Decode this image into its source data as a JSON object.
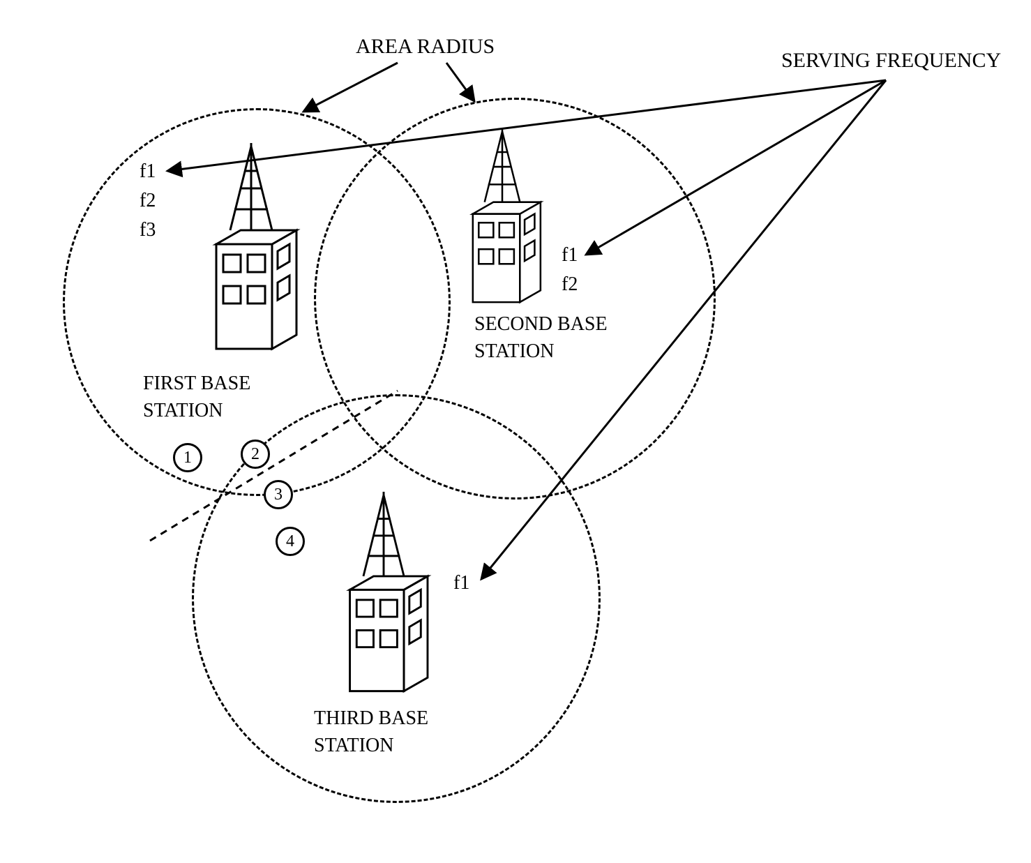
{
  "labels": {
    "area_radius": "AREA RADIUS",
    "serving_frequency": "SERVING FREQUENCY"
  },
  "stations": {
    "first": {
      "name": "FIRST BASE\nSTATION",
      "frequencies": [
        "f1",
        "f2",
        "f3"
      ]
    },
    "second": {
      "name": "SECOND BASE\nSTATION",
      "frequencies": [
        "f1",
        "f2"
      ]
    },
    "third": {
      "name": "THIRD BASE\nSTATION",
      "frequencies": [
        "f1"
      ]
    }
  },
  "points": {
    "p1": "1",
    "p2": "2",
    "p3": "3",
    "p4": "4"
  }
}
